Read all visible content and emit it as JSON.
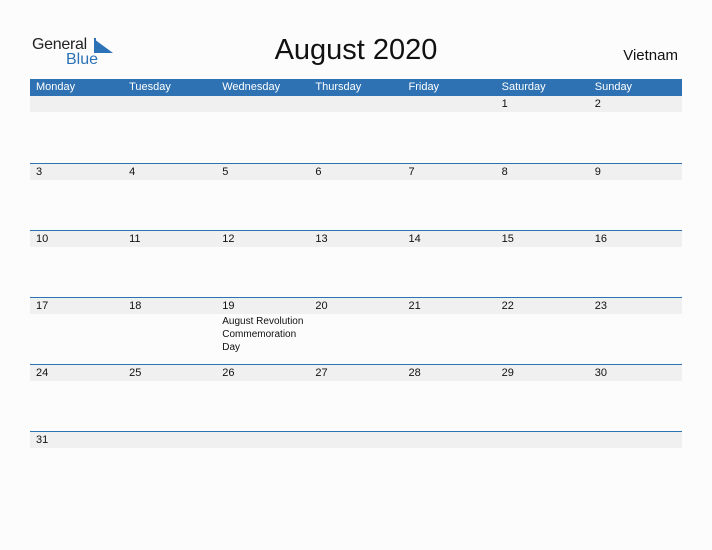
{
  "logo": {
    "text_general": "General",
    "text_blue": "Blue",
    "icon": "triangle-flag-icon",
    "accent": "#2b73b6"
  },
  "title": "August 2020",
  "country": "Vietnam",
  "colors": {
    "header_bg": "#2e72b3",
    "date_strip": "#f0f0f0"
  },
  "weekdays": [
    "Monday",
    "Tuesday",
    "Wednesday",
    "Thursday",
    "Friday",
    "Saturday",
    "Sunday"
  ],
  "weeks": [
    {
      "days": [
        {
          "n": "",
          "e": ""
        },
        {
          "n": "",
          "e": ""
        },
        {
          "n": "",
          "e": ""
        },
        {
          "n": "",
          "e": ""
        },
        {
          "n": "",
          "e": ""
        },
        {
          "n": "1",
          "e": ""
        },
        {
          "n": "2",
          "e": ""
        }
      ]
    },
    {
      "days": [
        {
          "n": "3",
          "e": ""
        },
        {
          "n": "4",
          "e": ""
        },
        {
          "n": "5",
          "e": ""
        },
        {
          "n": "6",
          "e": ""
        },
        {
          "n": "7",
          "e": ""
        },
        {
          "n": "8",
          "e": ""
        },
        {
          "n": "9",
          "e": ""
        }
      ]
    },
    {
      "days": [
        {
          "n": "10",
          "e": ""
        },
        {
          "n": "11",
          "e": ""
        },
        {
          "n": "12",
          "e": ""
        },
        {
          "n": "13",
          "e": ""
        },
        {
          "n": "14",
          "e": ""
        },
        {
          "n": "15",
          "e": ""
        },
        {
          "n": "16",
          "e": ""
        }
      ]
    },
    {
      "days": [
        {
          "n": "17",
          "e": ""
        },
        {
          "n": "18",
          "e": ""
        },
        {
          "n": "19",
          "e": "August Revolution Commemoration Day"
        },
        {
          "n": "20",
          "e": ""
        },
        {
          "n": "21",
          "e": ""
        },
        {
          "n": "22",
          "e": ""
        },
        {
          "n": "23",
          "e": ""
        }
      ]
    },
    {
      "days": [
        {
          "n": "24",
          "e": ""
        },
        {
          "n": "25",
          "e": ""
        },
        {
          "n": "26",
          "e": ""
        },
        {
          "n": "27",
          "e": ""
        },
        {
          "n": "28",
          "e": ""
        },
        {
          "n": "29",
          "e": ""
        },
        {
          "n": "30",
          "e": ""
        }
      ]
    },
    {
      "days": [
        {
          "n": "31",
          "e": ""
        },
        {
          "n": "",
          "e": ""
        },
        {
          "n": "",
          "e": ""
        },
        {
          "n": "",
          "e": ""
        },
        {
          "n": "",
          "e": ""
        },
        {
          "n": "",
          "e": ""
        },
        {
          "n": "",
          "e": ""
        }
      ]
    }
  ]
}
